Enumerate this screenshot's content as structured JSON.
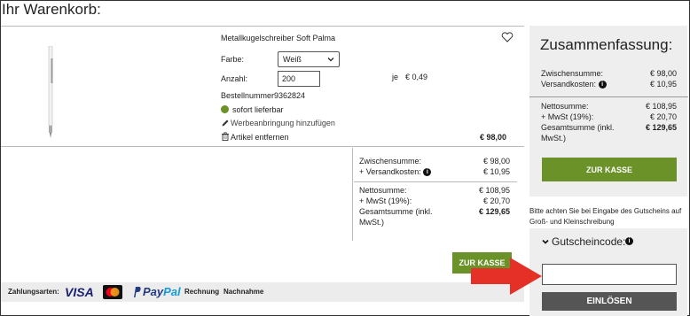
{
  "page": {
    "title": "Ihr Warenkorb:"
  },
  "product": {
    "name": "Metallkugelschreiber Soft Palma",
    "color_label": "Farbe:",
    "color_value": "Weiß",
    "qty_label": "Anzahl:",
    "qty_value": "200",
    "unit_price_prefix": "je",
    "unit_price": "€ 0,49",
    "order_number_label": "Bestellnummer",
    "order_number": "9362824",
    "availability": "sofort lieferbar",
    "add_branding": "Werbeanbringung hinzufügen",
    "remove": "Artikel entfernen",
    "line_total": "€ 98,00"
  },
  "totals": {
    "subtotal_label": "Zwischensumme:",
    "subtotal": "€ 98,00",
    "shipping_label": "+ Versandkosten:",
    "shipping": "€ 10,95",
    "net_label": "Nettosumme:",
    "net": "€ 108,95",
    "vat_label": "+ MwSt (19%):",
    "vat": "€ 20,70",
    "grand_label": "Gesamtsumme (inkl. MwSt.)",
    "grand": "€ 129,65",
    "checkout": "ZUR KASSE"
  },
  "payment": {
    "label": "Zahlungsarten:",
    "visa": "VISA",
    "paypal_a": "Pay",
    "paypal_b": "Pal",
    "invoice": "Rechnung",
    "cod": "Nachnahme"
  },
  "summary": {
    "title": "Zusammenfassung:",
    "subtotal_label": "Zwischensumme:",
    "subtotal": "€ 98,00",
    "shipping_label": "Versandkosten:",
    "shipping": "€ 10,95",
    "net_label": "Nettosumme:",
    "net": "€ 108,95",
    "vat_label": "+ MwSt (19%):",
    "vat": "€ 20,70",
    "grand_label": "Gesamtsumme (inkl. MwSt.)",
    "grand": "€ 129,65",
    "checkout": "ZUR KASSE"
  },
  "voucher": {
    "note": "Bitte achten Sie bei Eingabe des Gutscheins auf Groß- und Kleinschreibung",
    "label": "Gutscheincode:",
    "value": "",
    "submit": "EINLÖSEN"
  },
  "colors": {
    "accent": "#6b9229",
    "arrow": "#e53027",
    "dark_button": "#555555",
    "panel": "#eeeeee"
  },
  "icons": [
    "heart-icon",
    "chevron-down-icon",
    "pencil-icon",
    "trash-icon",
    "info-icon",
    "chevron-down-icon",
    "arrow-icon"
  ]
}
